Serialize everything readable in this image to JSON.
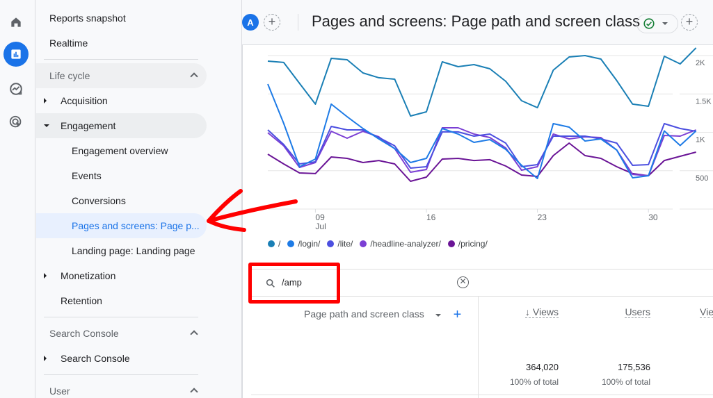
{
  "rail": {
    "items": [
      {
        "name": "home",
        "icon": "home-icon",
        "active": false
      },
      {
        "name": "reports",
        "icon": "bar-chart-icon",
        "active": true
      },
      {
        "name": "explore",
        "icon": "explore-trend-icon",
        "active": false
      },
      {
        "name": "advertising",
        "icon": "target-cursor-icon",
        "active": false
      }
    ]
  },
  "nav": {
    "reports_snapshot": "Reports snapshot",
    "realtime": "Realtime",
    "life_cycle": "Life cycle",
    "acquisition": "Acquisition",
    "engagement": "Engagement",
    "engagement_overview": "Engagement overview",
    "events": "Events",
    "conversions": "Conversions",
    "pages_and_screens": "Pages and screens: Page p...",
    "landing_page": "Landing page: Landing page",
    "monetization": "Monetization",
    "retention": "Retention",
    "search_console_section": "Search Console",
    "search_console": "Search Console",
    "user_section": "User"
  },
  "header": {
    "avatar_letter": "A",
    "add_comparison": "+",
    "title": "Pages and screens: Page path and screen class",
    "status_icon": "check-circle-icon",
    "add_report": "+"
  },
  "chart_data": {
    "type": "line",
    "title": "",
    "xlabel": "",
    "ylabel": "",
    "x": [
      "Jul 6",
      "Jul 7",
      "Jul 8",
      "Jul 9",
      "Jul 10",
      "Jul 11",
      "Jul 12",
      "Jul 13",
      "Jul 14",
      "Jul 15",
      "Jul 16",
      "Jul 17",
      "Jul 18",
      "Jul 19",
      "Jul 20",
      "Jul 21",
      "Jul 22",
      "Jul 23",
      "Jul 24",
      "Jul 25",
      "Jul 26",
      "Jul 27",
      "Jul 28",
      "Jul 29",
      "Jul 30",
      "Jul 31",
      "Aug 1",
      "Aug 2"
    ],
    "x_ticks": [
      {
        "index": 3,
        "label": "09",
        "sublabel": "Jul"
      },
      {
        "index": 10,
        "label": "16",
        "sublabel": ""
      },
      {
        "index": 17,
        "label": "23",
        "sublabel": ""
      },
      {
        "index": 24,
        "label": "30",
        "sublabel": ""
      }
    ],
    "y_ticks": [
      {
        "value": 0,
        "label": ""
      },
      {
        "value": 500,
        "label": "500"
      },
      {
        "value": 1000,
        "label": "1K"
      },
      {
        "value": 1500,
        "label": "1.5K"
      },
      {
        "value": 2000,
        "label": "2K"
      }
    ],
    "ylim": [
      0,
      2000
    ],
    "grid": true,
    "legend_position": "bottom-left",
    "series": [
      {
        "name": "/",
        "color": "#1a7fb5",
        "values": [
          1928,
          1910,
          1638,
          1367,
          1964,
          1946,
          1774,
          1711,
          1692,
          1213,
          1267,
          1919,
          1855,
          1882,
          1828,
          1665,
          1412,
          1321,
          1810,
          1982,
          2000,
          1955,
          1674,
          1367,
          1339,
          1991,
          1891,
          2100
        ]
      },
      {
        "name": "/login/",
        "color": "#1e7be6",
        "values": [
          1629,
          1118,
          552,
          652,
          1367,
          1204,
          1050,
          914,
          788,
          606,
          661,
          1050,
          977,
          869,
          905,
          778,
          570,
          398,
          1113,
          1068,
          887,
          914,
          769,
          407,
          434,
          1018,
          828,
          1018
        ]
      },
      {
        "name": "/lite/",
        "color": "#4c4fe0",
        "values": [
          1032,
          842,
          588,
          615,
          1077,
          1032,
          1032,
          932,
          824,
          534,
          552,
          1005,
          1005,
          950,
          977,
          860,
          552,
          579,
          950,
          950,
          950,
          914,
          860,
          570,
          579,
          1113,
          1050,
          1014
        ]
      },
      {
        "name": "/headline-analyzer/",
        "color": "#7b3fd4",
        "values": [
          995,
          824,
          543,
          606,
          1014,
          923,
          1014,
          941,
          787,
          480,
          516,
          1059,
          1059,
          977,
          932,
          796,
          507,
          552,
          977,
          914,
          941,
          932,
          769,
          452,
          434,
          959,
          950,
          1032
        ]
      },
      {
        "name": "/pricing/",
        "color": "#6a1496",
        "values": [
          715,
          588,
          471,
          462,
          679,
          661,
          606,
          633,
          588,
          362,
          416,
          652,
          661,
          633,
          643,
          561,
          443,
          425,
          697,
          860,
          697,
          661,
          552,
          462,
          434,
          633,
          688,
          742
        ]
      }
    ]
  },
  "search": {
    "icon": "search-icon",
    "value": "/amp",
    "clear_icon": "clear-circle-icon"
  },
  "table": {
    "dimension_header": "Page path and screen class",
    "add_dimension": "+",
    "columns": [
      {
        "label": "Views",
        "sorted": "desc",
        "total": "364,020",
        "pct": "100% of total"
      },
      {
        "label": "Users",
        "sorted": "",
        "total": "175,536",
        "pct": "100% of total"
      },
      {
        "label": "Vie",
        "sorted": "",
        "total": "",
        "pct": ""
      }
    ]
  },
  "annotations": {
    "arrow_color": "#ff0000",
    "box_color": "#ff0000"
  }
}
